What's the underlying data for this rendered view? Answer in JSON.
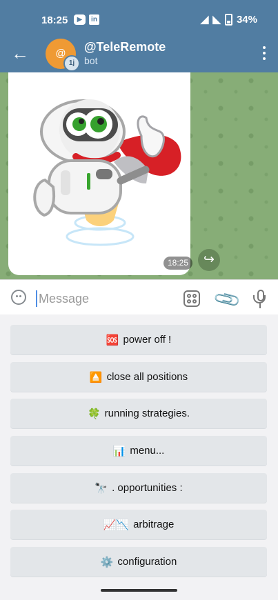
{
  "status": {
    "time": "18:25",
    "battery": "34%",
    "app_icons": [
      "youtube-icon",
      "linkedin-icon"
    ]
  },
  "header": {
    "avatar_text": "@",
    "avatar_badge": "1j",
    "title": "@TeleRemote",
    "subtitle": "bot"
  },
  "message": {
    "time": "18:25"
  },
  "composer": {
    "placeholder": "Message"
  },
  "keyboard_buttons": [
    {
      "emoji": "🆘",
      "label": "power off !"
    },
    {
      "emoji": "⏏️",
      "label": "close all positions"
    },
    {
      "emoji": "🍀",
      "label": "running strategies."
    },
    {
      "emoji": "📊",
      "label": "menu..."
    },
    {
      "emoji": "🔭",
      "label": ". opportunities :"
    },
    {
      "emoji": "📈📉",
      "label": "arbitrage"
    },
    {
      "emoji": "⚙️",
      "label": "configuration"
    }
  ],
  "colors": {
    "header": "#517da2",
    "chat_background": "#87ad77",
    "button_background": "#e3e6e9"
  }
}
